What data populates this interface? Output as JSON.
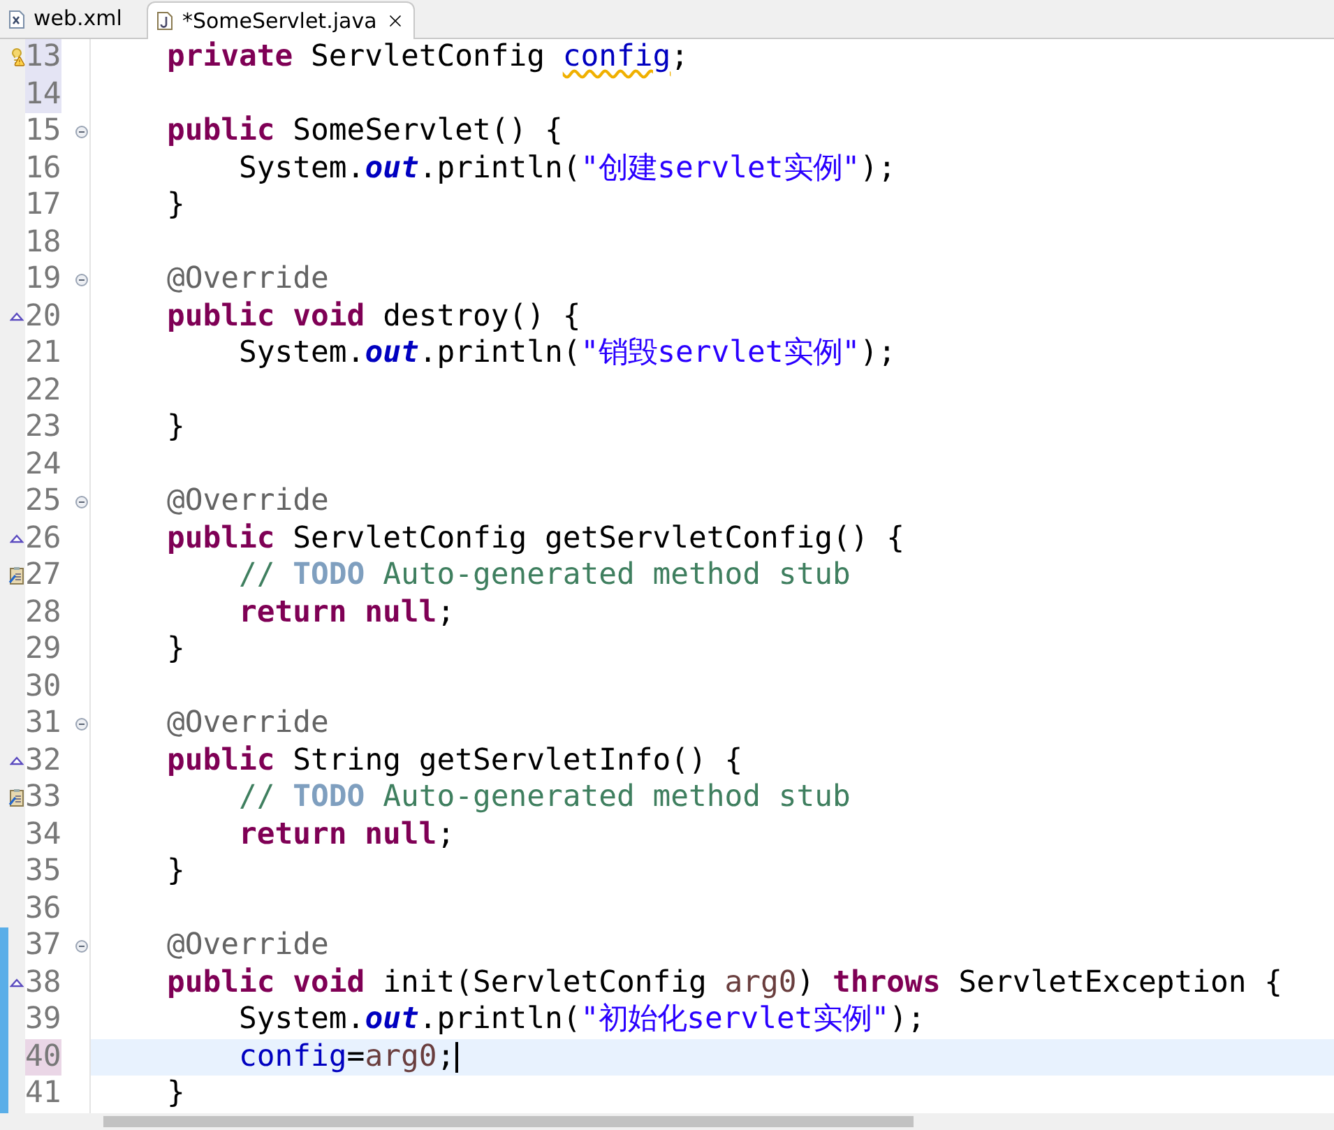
{
  "tabs": [
    {
      "label": "web.xml",
      "kind": "xml",
      "selected": false,
      "closable": false
    },
    {
      "label": "*SomeServlet.java",
      "kind": "java",
      "selected": true,
      "closable": true
    }
  ],
  "lines": [
    {
      "number": "13",
      "kind": "warning",
      "fold": false,
      "changed": false,
      "marked": true,
      "current": false,
      "segments": [
        {
          "t": "    private",
          "kind": "keyword"
        },
        {
          "t": " ServletConfig ",
          "kind": "plain"
        },
        {
          "t": "config",
          "kind": "field",
          "warning": true
        },
        {
          "t": ";",
          "kind": "plain"
        }
      ]
    },
    {
      "number": "14",
      "kind": "plain",
      "fold": false,
      "changed": false,
      "marked": true,
      "current": false
    },
    {
      "number": "15",
      "kind": "plain",
      "fold": true,
      "changed": false,
      "marked": false,
      "current": false,
      "segments": [
        {
          "t": "    public",
          "kind": "keyword"
        },
        {
          "t": " SomeServlet() {",
          "kind": "plain"
        }
      ]
    },
    {
      "number": "16",
      "kind": "plain",
      "fold": false,
      "changed": false,
      "marked": false,
      "current": false,
      "segments": [
        {
          "t": "        System.",
          "kind": "plain"
        },
        {
          "t": "out",
          "kind": "static"
        },
        {
          "t": ".println(",
          "kind": "plain"
        },
        {
          "t": "\"创建servlet实例\"",
          "kind": "string"
        },
        {
          "t": ");",
          "kind": "plain"
        }
      ]
    },
    {
      "number": "17",
      "kind": "plain",
      "fold": false,
      "changed": false,
      "marked": false,
      "current": false,
      "segments": [
        {
          "t": "    }",
          "kind": "plain"
        }
      ]
    },
    {
      "number": "18",
      "kind": "plain",
      "fold": false,
      "changed": false,
      "marked": false,
      "current": false
    },
    {
      "number": "19",
      "kind": "plain",
      "fold": true,
      "changed": false,
      "marked": false,
      "current": false,
      "segments": [
        {
          "t": "    @Override",
          "kind": "annotation"
        }
      ]
    },
    {
      "number": "20",
      "kind": "override",
      "fold": false,
      "changed": false,
      "marked": false,
      "current": false,
      "segments": [
        {
          "t": "    public void",
          "kind": "keyword"
        },
        {
          "t": " destroy() {",
          "kind": "plain"
        }
      ]
    },
    {
      "number": "21",
      "kind": "plain",
      "fold": false,
      "changed": false,
      "marked": false,
      "current": false,
      "segments": [
        {
          "t": "        System.",
          "kind": "plain"
        },
        {
          "t": "out",
          "kind": "static"
        },
        {
          "t": ".println(",
          "kind": "plain"
        },
        {
          "t": "\"销毁servlet实例\"",
          "kind": "string"
        },
        {
          "t": ");",
          "kind": "plain"
        }
      ]
    },
    {
      "number": "22",
      "kind": "plain",
      "fold": false,
      "changed": false,
      "marked": false,
      "current": false
    },
    {
      "number": "23",
      "kind": "plain",
      "fold": false,
      "changed": false,
      "marked": false,
      "current": false,
      "segments": [
        {
          "t": "    }",
          "kind": "plain"
        }
      ]
    },
    {
      "number": "24",
      "kind": "plain",
      "fold": false,
      "changed": false,
      "marked": false,
      "current": false
    },
    {
      "number": "25",
      "kind": "plain",
      "fold": true,
      "changed": false,
      "marked": false,
      "current": false,
      "segments": [
        {
          "t": "    @Override",
          "kind": "annotation"
        }
      ]
    },
    {
      "number": "26",
      "kind": "override",
      "fold": false,
      "changed": false,
      "marked": false,
      "current": false,
      "segments": [
        {
          "t": "    public",
          "kind": "keyword"
        },
        {
          "t": " ServletConfig getServletConfig() {",
          "kind": "plain"
        }
      ]
    },
    {
      "number": "27",
      "kind": "task",
      "fold": false,
      "changed": false,
      "marked": false,
      "current": false,
      "segments": [
        {
          "t": "        // ",
          "kind": "comment"
        },
        {
          "t": "TODO",
          "kind": "todo"
        },
        {
          "t": " Auto-generated method stub",
          "kind": "comment"
        }
      ]
    },
    {
      "number": "28",
      "kind": "plain",
      "fold": false,
      "changed": false,
      "marked": false,
      "current": false,
      "segments": [
        {
          "t": "        return null",
          "kind": "keyword"
        },
        {
          "t": ";",
          "kind": "plain"
        }
      ]
    },
    {
      "number": "29",
      "kind": "plain",
      "fold": false,
      "changed": false,
      "marked": false,
      "current": false,
      "segments": [
        {
          "t": "    }",
          "kind": "plain"
        }
      ]
    },
    {
      "number": "30",
      "kind": "plain",
      "fold": false,
      "changed": false,
      "marked": false,
      "current": false
    },
    {
      "number": "31",
      "kind": "plain",
      "fold": true,
      "changed": false,
      "marked": false,
      "current": false,
      "segments": [
        {
          "t": "    @Override",
          "kind": "annotation"
        }
      ]
    },
    {
      "number": "32",
      "kind": "override",
      "fold": false,
      "changed": false,
      "marked": false,
      "current": false,
      "segments": [
        {
          "t": "    public",
          "kind": "keyword"
        },
        {
          "t": " String getServletInfo() {",
          "kind": "plain"
        }
      ]
    },
    {
      "number": "33",
      "kind": "task",
      "fold": false,
      "changed": false,
      "marked": false,
      "current": false,
      "segments": [
        {
          "t": "        // ",
          "kind": "comment"
        },
        {
          "t": "TODO",
          "kind": "todo"
        },
        {
          "t": " Auto-generated method stub",
          "kind": "comment"
        }
      ]
    },
    {
      "number": "34",
      "kind": "plain",
      "fold": false,
      "changed": false,
      "marked": false,
      "current": false,
      "segments": [
        {
          "t": "        return null",
          "kind": "keyword"
        },
        {
          "t": ";",
          "kind": "plain"
        }
      ]
    },
    {
      "number": "35",
      "kind": "plain",
      "fold": false,
      "changed": false,
      "marked": false,
      "current": false,
      "segments": [
        {
          "t": "    }",
          "kind": "plain"
        }
      ]
    },
    {
      "number": "36",
      "kind": "plain",
      "fold": false,
      "changed": false,
      "marked": false,
      "current": false
    },
    {
      "number": "37",
      "kind": "plain",
      "fold": true,
      "changed": true,
      "marked": false,
      "current": false,
      "segments": [
        {
          "t": "    @Override",
          "kind": "annotation"
        }
      ]
    },
    {
      "number": "38",
      "kind": "override",
      "fold": false,
      "changed": true,
      "marked": false,
      "current": false,
      "segments": [
        {
          "t": "    public void",
          "kind": "keyword"
        },
        {
          "t": " init(ServletConfig ",
          "kind": "plain"
        },
        {
          "t": "arg0",
          "kind": "param"
        },
        {
          "t": ") ",
          "kind": "plain"
        },
        {
          "t": "throws",
          "kind": "keyword"
        },
        {
          "t": " ServletException {",
          "kind": "plain"
        }
      ]
    },
    {
      "number": "39",
      "kind": "plain",
      "fold": false,
      "changed": true,
      "marked": false,
      "current": false,
      "segments": [
        {
          "t": "        System.",
          "kind": "plain"
        },
        {
          "t": "out",
          "kind": "static"
        },
        {
          "t": ".println(",
          "kind": "plain"
        },
        {
          "t": "\"初始化servlet实例\"",
          "kind": "string"
        },
        {
          "t": ");",
          "kind": "plain"
        }
      ]
    },
    {
      "number": "40",
      "kind": "plain",
      "fold": false,
      "changed": true,
      "marked": false,
      "current": true,
      "segments": [
        {
          "t": "        config",
          "kind": "field",
          "warning": false
        },
        {
          "t": "=",
          "kind": "plain"
        },
        {
          "t": "arg0",
          "kind": "param"
        },
        {
          "t": ";",
          "kind": "plain"
        }
      ]
    },
    {
      "number": "41",
      "kind": "plain",
      "fold": false,
      "changed": true,
      "marked": false,
      "current": false,
      "segments": [
        {
          "t": "    }",
          "kind": "plain"
        }
      ]
    }
  ]
}
